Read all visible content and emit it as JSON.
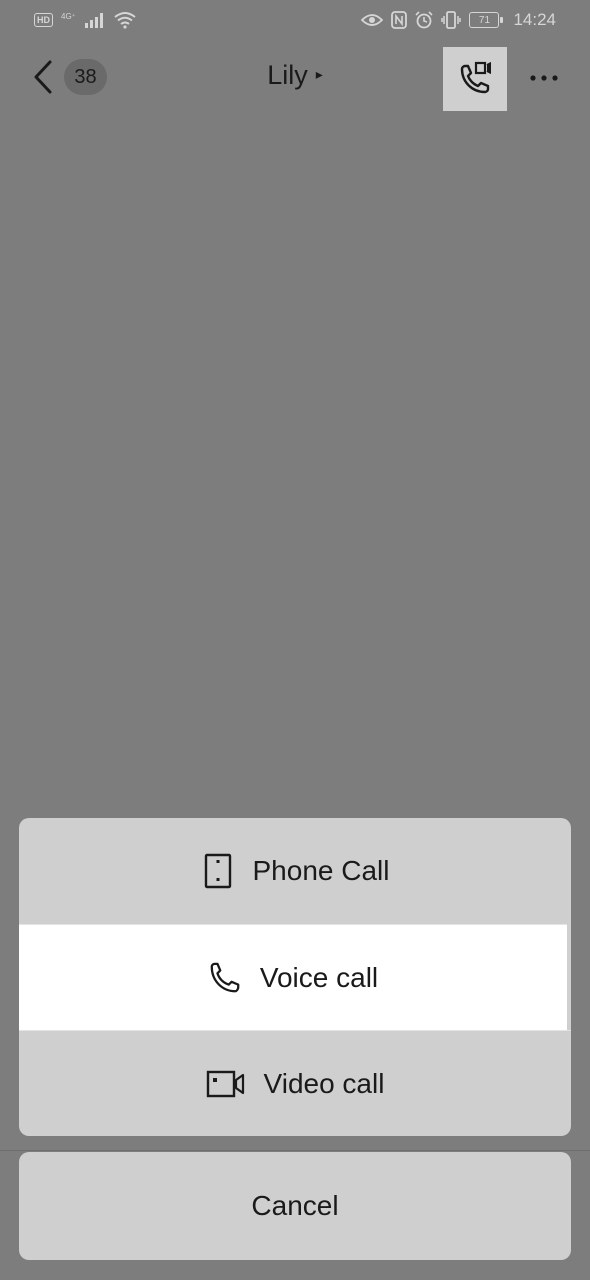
{
  "status_bar": {
    "hd": "HD",
    "network": "4G⁺",
    "battery": "71",
    "time": "14:24",
    "icons": [
      "signal-icon",
      "wifi-icon",
      "eye-icon",
      "nfc-icon",
      "alarm-icon",
      "vibrate-icon",
      "battery-icon"
    ]
  },
  "header": {
    "unread_count": "38",
    "title": "Lily",
    "caret": "▸",
    "icons": [
      "back-arrow-icon",
      "phone-video-icon",
      "more-icon"
    ]
  },
  "action_sheet": {
    "options": [
      {
        "label": "Phone Call",
        "icon": "mobile-phone-icon"
      },
      {
        "label": "Voice call",
        "icon": "phone-handset-icon"
      },
      {
        "label": "Video call",
        "icon": "video-camera-icon"
      }
    ],
    "cancel_label": "Cancel"
  },
  "colors": {
    "overlay": "#7d7d7d",
    "sheet": "#cfcfcf",
    "selected": "#ffffff"
  }
}
